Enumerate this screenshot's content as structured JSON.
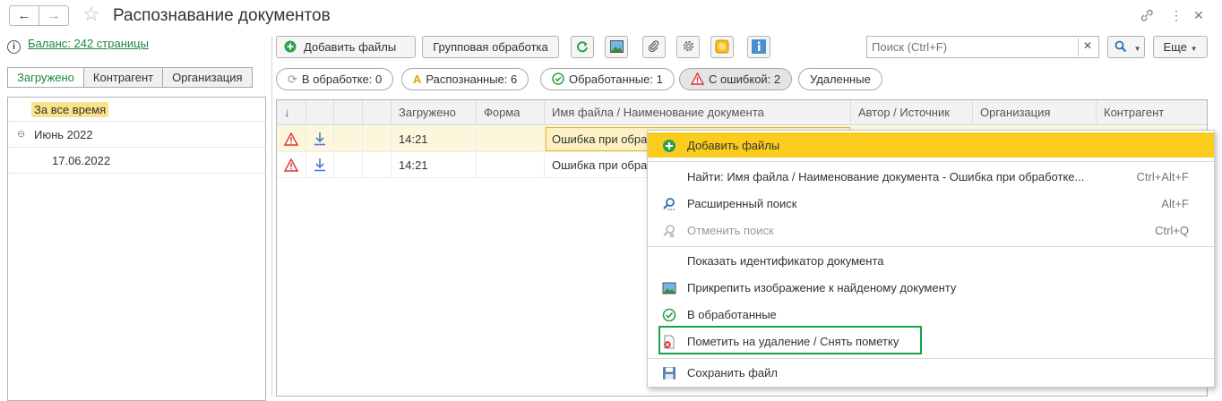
{
  "header": {
    "title": "Распознавание документов"
  },
  "balance": {
    "link": "Баланс: 242 страницы"
  },
  "left_tabs": [
    {
      "label": "Загружено"
    },
    {
      "label": "Контрагент"
    },
    {
      "label": "Организация"
    }
  ],
  "tree": {
    "all_time": "За все время",
    "month": "Июнь 2022",
    "date": "17.06.2022"
  },
  "toolbar": {
    "add_files": "Добавить файлы",
    "group_processing": "Групповая обработка",
    "more": "Еще"
  },
  "search": {
    "placeholder": "Поиск (Ctrl+F)"
  },
  "filters": [
    {
      "label": "В обработке: 0"
    },
    {
      "label": "Распознанные: 6"
    },
    {
      "label": "Обработанные: 1"
    },
    {
      "label": "С ошибкой: 2"
    },
    {
      "label": "Удаленные"
    }
  ],
  "grid": {
    "columns": [
      "↓",
      "Загружено",
      "Форма",
      "Имя файла / Наименование документа",
      "Автор / Источник",
      "Организация",
      "Контрагент"
    ],
    "rows": [
      {
        "time": "14:21",
        "name": "Ошибка при обраб"
      },
      {
        "time": "14:21",
        "name": "Ошибка при обраб"
      }
    ]
  },
  "context_menu": {
    "items": [
      {
        "label": "Добавить файлы",
        "shortcut": ""
      },
      {
        "label": "Найти: Имя файла / Наименование документа - Ошибка при обработке...",
        "shortcut": "Ctrl+Alt+F"
      },
      {
        "label": "Расширенный поиск",
        "shortcut": "Alt+F"
      },
      {
        "label": "Отменить поиск",
        "shortcut": "Ctrl+Q"
      },
      {
        "label": "Показать идентификатор документа",
        "shortcut": ""
      },
      {
        "label": "Прикрепить изображение к найденому документу",
        "shortcut": ""
      },
      {
        "label": "В обработанные",
        "shortcut": ""
      },
      {
        "label": "Пометить на удаление / Снять пометку",
        "shortcut": ""
      },
      {
        "label": "Сохранить файл",
        "shortcut": ""
      }
    ]
  },
  "colors": {
    "accent_green": "#1a8a3a",
    "highlight_yellow": "#f9cc1e",
    "error_red": "#e03030",
    "focus_green": "#1aa34a"
  }
}
